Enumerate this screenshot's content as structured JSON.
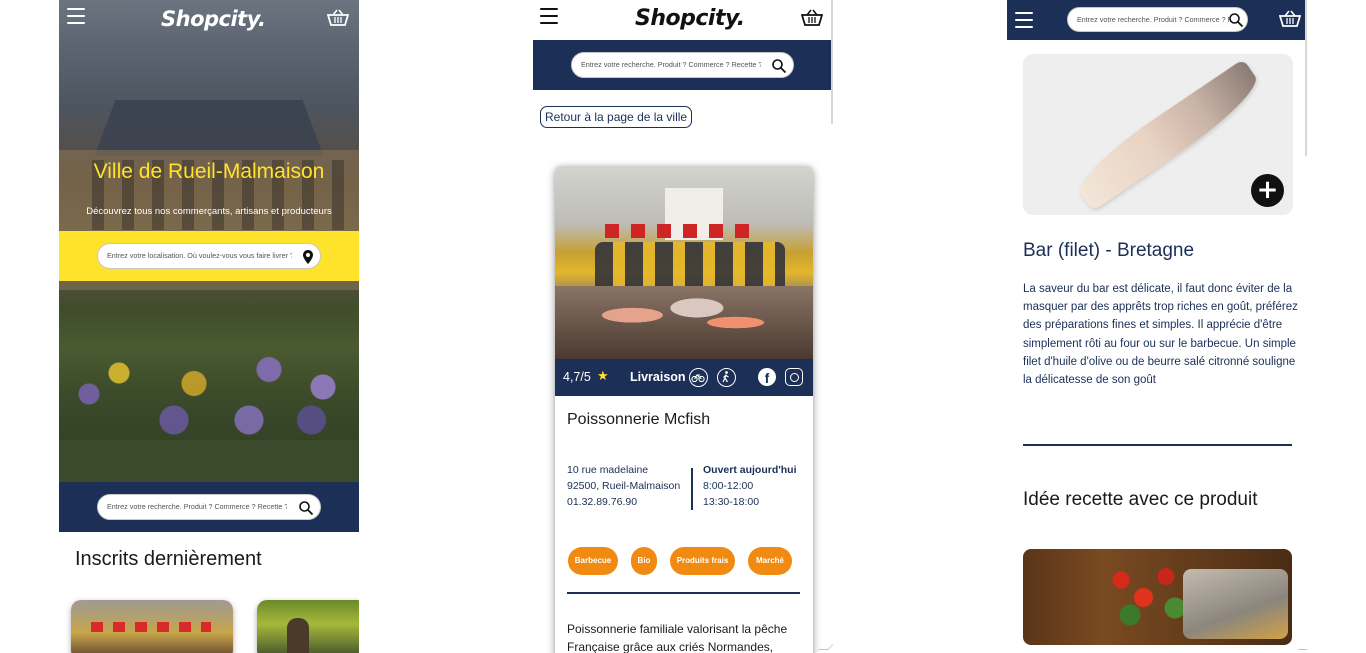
{
  "brand": {
    "logo_text": "Shopcity.",
    "navy": "#1b2f57",
    "yellow": "#ffe22a",
    "orange": "#f08a11"
  },
  "panel_home": {
    "city_title": "Ville de Rueil-Malmaison",
    "subtitle": "Découvrez tous nos commerçants, artisans et producteurs",
    "location_search": {
      "placeholder": "Entrez votre localisation. Où voulez-vous vous faire livrer ?",
      "icon": "location-pin-icon"
    },
    "product_search": {
      "placeholder": "Entrez votre recherche. Produit ? Commerce ? Recette ?",
      "icon": "search-icon"
    },
    "recent_heading": "Inscrits dernièrement"
  },
  "panel_shop": {
    "search": {
      "placeholder": "Entrez votre recherche. Produit ? Commerce ? Recette ?",
      "icon": "search-icon"
    },
    "back_button": "Retour à la page de la ville",
    "rating": "4,7/5",
    "delivery_label": "Livraison",
    "delivery_icons": [
      "bicycle-icon",
      "walking-icon"
    ],
    "social_icons": [
      "facebook-icon",
      "instagram-icon"
    ],
    "shop_name": "Poissonnerie Mcfish",
    "address": {
      "street": "10 rue madelaine",
      "city": "92500, Rueil-Malmaison",
      "phone": "01.32.89.76.90"
    },
    "hours": {
      "title": "Ouvert aujourd'hui",
      "slot1": "8:00-12:00",
      "slot2": "13:30-18:00"
    },
    "tags": [
      "Barbecue",
      "Bio",
      "Produits frais",
      "Marché"
    ],
    "description": "Poissonnerie familiale valorisant la pêche Française grâce aux criés Normandes,"
  },
  "panel_product": {
    "search": {
      "placeholder": "Entrez votre recherche. Produit ? Commerce ? Recette ?",
      "icon": "search-icon"
    },
    "product_title": "Bar (filet) - Bretagne",
    "add_button": "+",
    "description": "La saveur du bar est délicate, il faut donc éviter de la masquer par des apprêts trop riches en goût, préférez des préparations fines et simples. Il apprécie d'être simplement rôti au four ou sur le barbecue. Un simple filet d'huile d'olive ou de beurre salé citronné souligne la délicatesse de son goût",
    "recipe_heading": "Idée recette avec ce produit"
  }
}
